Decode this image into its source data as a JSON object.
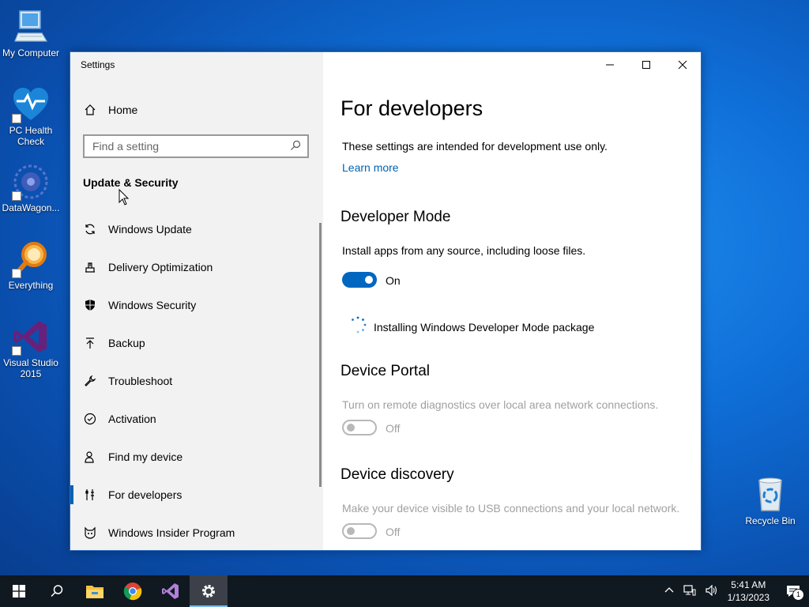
{
  "desktop": {
    "icons": [
      {
        "label": "My Computer"
      },
      {
        "label": "PC Health Check"
      },
      {
        "label": "DataWagon..."
      },
      {
        "label": "Everything"
      },
      {
        "label": "Visual Studio 2015"
      },
      {
        "label": "Recycle Bin"
      }
    ]
  },
  "window": {
    "title": "Settings",
    "sidebar": {
      "home_label": "Home",
      "search_placeholder": "Find a setting",
      "section": "Update & Security",
      "items": [
        {
          "label": "Windows Update",
          "icon": "refresh-icon"
        },
        {
          "label": "Delivery Optimization",
          "icon": "delivery-icon"
        },
        {
          "label": "Windows Security",
          "icon": "shield-icon"
        },
        {
          "label": "Backup",
          "icon": "backup-arrow-icon"
        },
        {
          "label": "Troubleshoot",
          "icon": "wrench-icon"
        },
        {
          "label": "Activation",
          "icon": "check-circle-icon"
        },
        {
          "label": "Find my device",
          "icon": "person-location-icon"
        },
        {
          "label": "For developers",
          "icon": "developer-tools-icon",
          "active": true
        },
        {
          "label": "Windows Insider Program",
          "icon": "insider-cat-icon"
        }
      ]
    },
    "content": {
      "page_title": "For developers",
      "intro": "These settings are intended for development use only.",
      "learn_more": "Learn more",
      "developer_mode": {
        "heading": "Developer Mode",
        "description": "Install apps from any source, including loose files.",
        "toggle_state": "On",
        "status": "Installing Windows Developer Mode package"
      },
      "device_portal": {
        "heading": "Device Portal",
        "description": "Turn on remote diagnostics over local area network connections.",
        "toggle_state": "Off"
      },
      "device_discovery": {
        "heading": "Device discovery",
        "description": "Make your device visible to USB connections and your local network.",
        "toggle_state": "Off"
      }
    }
  },
  "taskbar": {
    "time": "5:41 AM",
    "date": "1/13/2023",
    "notification_count": "1"
  },
  "colors": {
    "accent": "#0067c0",
    "link": "#0063b1",
    "disabled": "#a0a0a0"
  }
}
